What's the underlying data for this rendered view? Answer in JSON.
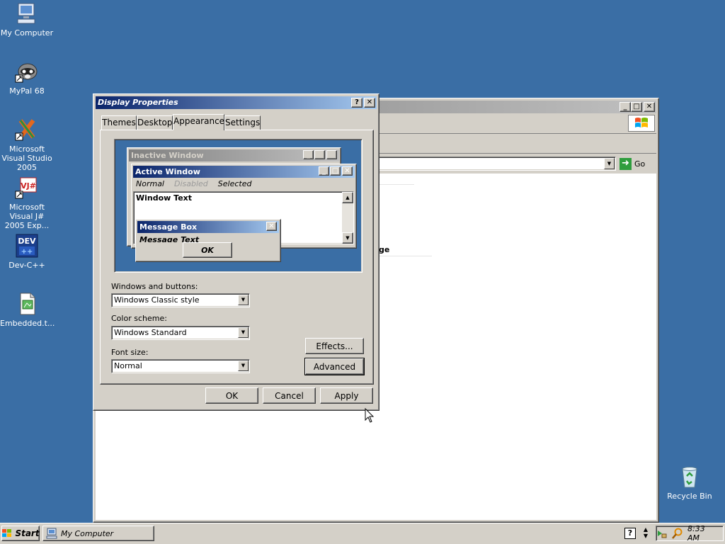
{
  "desktop": {
    "icons": [
      {
        "label": "My Computer"
      },
      {
        "label": "MyPal 68"
      },
      {
        "label": "Microsoft Visual Studio 2005"
      },
      {
        "label": "Microsoft Visual J# 2005 Exp..."
      },
      {
        "label": "Dev-C++"
      },
      {
        "label": "Embedded.t..."
      },
      {
        "label": "Recycle Bin"
      }
    ]
  },
  "explorer": {
    "go_label": "Go",
    "partial_text": "ge"
  },
  "dialog": {
    "title": "Display Properties",
    "tabs": [
      {
        "label": "Themes"
      },
      {
        "label": "Desktop"
      },
      {
        "label": "Appearance"
      },
      {
        "label": "Settings"
      }
    ],
    "active_tab": "Appearance",
    "preview": {
      "inactive_window_title": "Inactive Window",
      "active_window_title": "Active Window",
      "menu_normal": "Normal",
      "menu_disabled": "Disabled",
      "menu_selected": "Selected",
      "window_text": "Window Text",
      "message_box_title": "Message Box",
      "message_text": "Message Text",
      "ok_label": "OK"
    },
    "windows_buttons_label": "Windows and buttons:",
    "windows_buttons_value": "Windows Classic style",
    "color_scheme_label": "Color scheme:",
    "color_scheme_value": "Windows Standard",
    "font_size_label": "Font size:",
    "font_size_value": "Normal",
    "effects_label": "Effects...",
    "advanced_label": "Advanced",
    "ok_label": "OK",
    "cancel_label": "Cancel",
    "apply_label": "Apply"
  },
  "taskbar": {
    "start_label": "Start",
    "task_label": "My Computer",
    "clock": "8:33 AM"
  },
  "colors": {
    "desktop": "#3a6ea5",
    "active_title_start": "#0a246a",
    "active_title_end": "#a6caf0",
    "inactive_title_start": "#808080",
    "inactive_title_end": "#c0c0c0",
    "face": "#d4d0c8"
  }
}
